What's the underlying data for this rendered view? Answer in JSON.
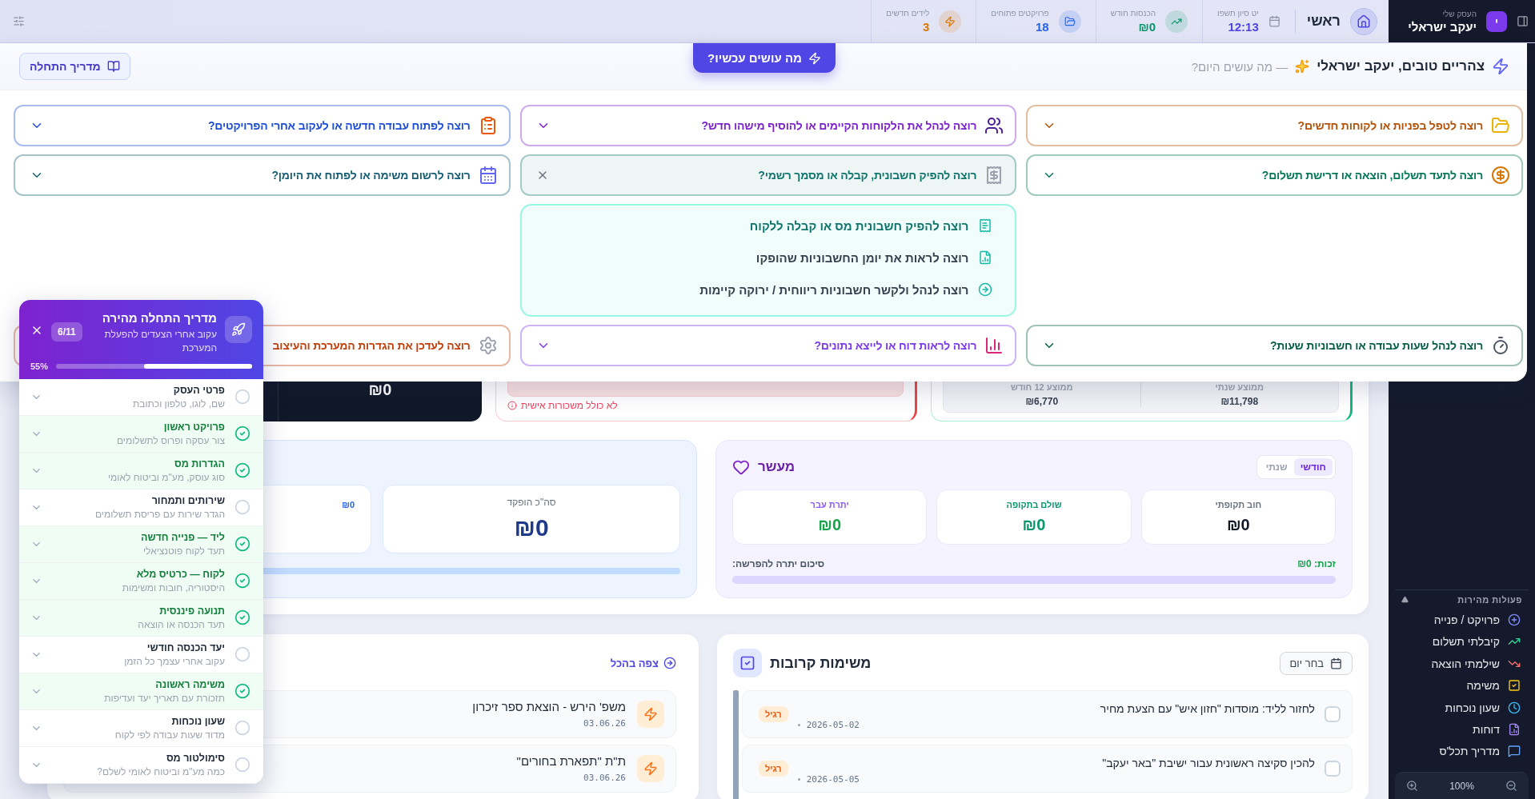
{
  "topbar": {
    "business_label": "העסק שלי",
    "business_name": "יעקב ישראלי",
    "avatar": "י",
    "home": "ראשי",
    "date_label": "יט סיון תשפו",
    "time": "12:13",
    "stats": [
      {
        "label": "הכנסות חודש",
        "value": "₪0",
        "color": "#059669"
      },
      {
        "label": "פרויקטים פתוחים",
        "value": "18",
        "color": "#2563eb"
      },
      {
        "label": "לידים חדשים",
        "value": "3",
        "color": "#d97706"
      }
    ]
  },
  "intent_panel": {
    "greeting": "צהריים טובים, יעקב ישראלי",
    "question": "— מה עושים היום?",
    "now_button": "מה עושים עכשיו?",
    "guide_button": "מדריך התחלה",
    "intents": [
      {
        "label": "רוצה לטפל בפניות או לקוחות חדשים?",
        "color": "#b45309",
        "expanded": false
      },
      {
        "label": "רוצה לנהל את הלקוחות הקיימים או להוסיף מישהו חדש?",
        "color": "#7e22ce",
        "expanded": false
      },
      {
        "label": "רוצה לפתוח עבודה חדשה או לעקוב אחרי הפרויקטים?",
        "color": "#1d4ed8",
        "expanded": false
      },
      {
        "label": "רוצה לתעד תשלום, הוצאה או דרישת תשלום?",
        "color": "#047857",
        "expanded": false
      },
      {
        "label": "רוצה להפיק חשבונית, קבלה או מסמך רשמי?",
        "color": "#0f766e",
        "expanded": true,
        "options": [
          {
            "label": "רוצה להפיק חשבונית מס או קבלה ללקוח",
            "selected": true
          },
          {
            "label": "רוצה לראות את יומן החשבוניות שהופקו",
            "selected": false
          },
          {
            "label": "רוצה לנהל ולקשר חשבוניות ריווחית / ירוקה קיימות",
            "selected": false
          }
        ]
      },
      {
        "label": "רוצה לרשום משימה או לפתוח את היומן?",
        "color": "#155e75",
        "expanded": false
      },
      {
        "label": "רוצה לנהל שעות עבודה או חשבוניות שעות?",
        "color": "#065f46",
        "expanded": false
      },
      {
        "label": "רוצה לראות דוח או לייצא נתונים?",
        "color": "#7c3aed",
        "expanded": false
      },
      {
        "label": "רוצה לעדכן את הגדרות המערכת והעיצוב",
        "color": "#c2410c",
        "expanded": false
      }
    ]
  },
  "dashboard": {
    "stats_cards": [
      {
        "kind": "averages",
        "items": [
          {
            "label": "ממוצע שנתי",
            "value": "₪11,798"
          },
          {
            "label": "ממוצע 12 חודש",
            "value": "₪6,770"
          }
        ]
      },
      {
        "kind": "note",
        "note": "לא כולל משכורות אישית"
      },
      {
        "kind": "total",
        "value": "₪0"
      }
    ],
    "deposits": {
      "total_label": "סה\"כ הופקד",
      "total_value": "₪0",
      "secondary_value": "₪0"
    },
    "tithe": {
      "title": "מעשר",
      "periods": [
        {
          "label": "חודשי",
          "selected": true
        },
        {
          "label": "שנתי",
          "selected": false
        }
      ],
      "cards": [
        {
          "kind": "debt",
          "label": "חוב תקופתי",
          "value": "₪0"
        },
        {
          "kind": "paid",
          "label": "שולם בתקופה",
          "value": "₪0"
        },
        {
          "kind": "carry",
          "label": "יתרת עבר",
          "value": "₪0"
        }
      ],
      "credit": "זכות: ₪0",
      "summary": "סיכום יתרה להפרשה:"
    },
    "tasks": {
      "title": "משימות קרובות",
      "pick_day": "בחר יום",
      "items": [
        {
          "title": "לחזור לליד: מוסדות \"חזון איש\" עם הצעת מחיר",
          "date": "2026-05-02",
          "priority": "רגיל",
          "checked": false
        },
        {
          "title": "להכין סקיצה ראשונית עבור ישיבת \"באר יעקב\"",
          "date": "2026-05-05",
          "priority": "רגיל",
          "checked": false
        }
      ]
    },
    "projects": {
      "view_all": "צפה בהכל",
      "items": [
        {
          "title": "משפ' הירש - הוצאת ספר זיכרון",
          "date": "03.06.26"
        },
        {
          "title": "ת\"ת \"תפארת בחורים\"",
          "date": "03.06.26"
        }
      ]
    }
  },
  "guide": {
    "title": "מדריך התחלה מהירה",
    "subtitle": "עקוב אחרי הצעדים להפעלת המערכת",
    "count": "6/11",
    "percent": "55%",
    "level": 0.55,
    "steps": [
      {
        "title": "פרטי העסק",
        "subtitle": "שם, לוגו, טלפון וכתובת",
        "done": false
      },
      {
        "title": "פרויקט ראשון",
        "subtitle": "צור עסקה ופרוס לתשלומים",
        "done": true
      },
      {
        "title": "הגדרות מס",
        "subtitle": "סוג עוסק, מע\"מ וביטוח לאומי",
        "done": true
      },
      {
        "title": "שירותים ותמחור",
        "subtitle": "הגדר שירות עם פריסת תשלומים",
        "done": false
      },
      {
        "title": "ליד — פנייה חדשה",
        "subtitle": "תעד לקוח פוטנציאלי",
        "done": true
      },
      {
        "title": "לקוח — כרטיס מלא",
        "subtitle": "היסטוריה, חובות ומשימות",
        "done": true
      },
      {
        "title": "תנועה פיננסית",
        "subtitle": "תעד הכנסה או הוצאה",
        "done": true
      },
      {
        "title": "יעד הכנסה חודשי",
        "subtitle": "עקוב אחרי עצמך כל הזמן",
        "done": false
      },
      {
        "title": "משימה ראשונה",
        "subtitle": "תזכורת עם תאריך יעד ועדיפות",
        "done": true
      },
      {
        "title": "שעון נוכחות",
        "subtitle": "מדוד שעות עבודה לפי לקוח",
        "done": false
      },
      {
        "title": "סימולטור מס",
        "subtitle": "כמה מע\"מ וביטוח לאומי לשלם?",
        "done": false
      }
    ]
  },
  "quick_actions": {
    "title": "פעולות מהירות",
    "items": [
      "פרויקט / פנייה",
      "קיבלתי תשלום",
      "שילמתי הוצאה",
      "משימה",
      "שעון נוכחות",
      "דוחות",
      "מדריך תכל'ס"
    ],
    "zoom": "100%"
  }
}
